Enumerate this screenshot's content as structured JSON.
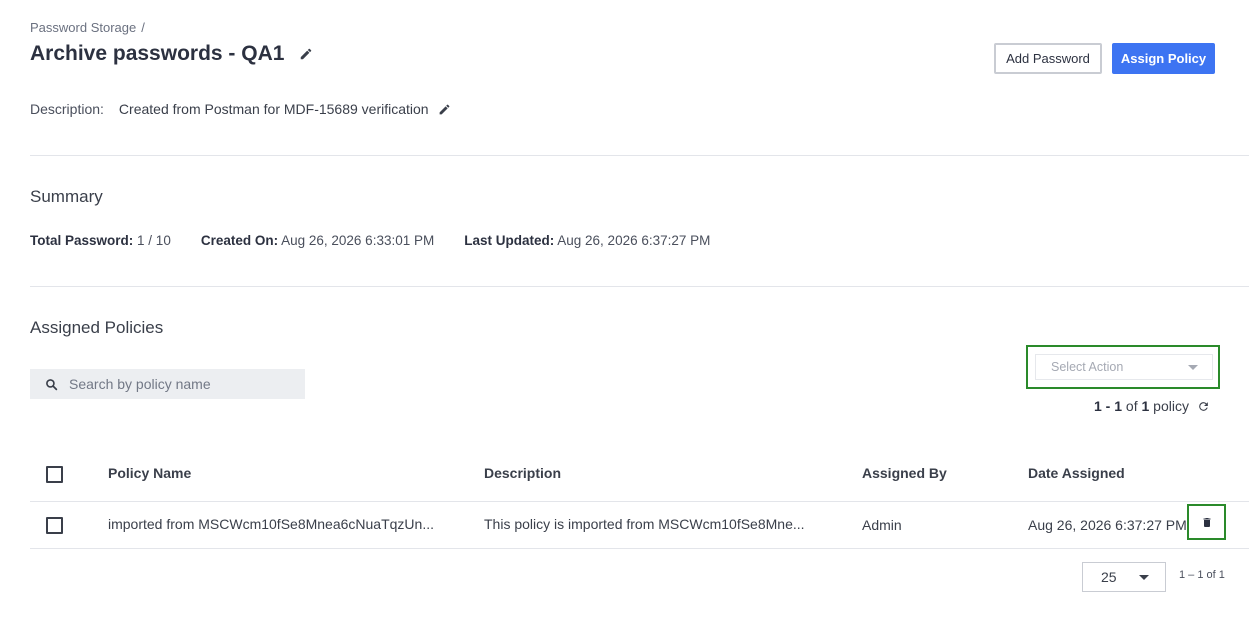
{
  "breadcrumb": {
    "root": "Password Storage",
    "separator": "/"
  },
  "header": {
    "title": "Archive passwords - QA1",
    "add_password_label": "Add Password",
    "assign_policy_label": "Assign Policy"
  },
  "description": {
    "label": "Description:",
    "value": "Created from Postman for MDF-15689 verification"
  },
  "summary": {
    "title": "Summary",
    "total_password_label": "Total Password:",
    "total_password_value": "1 / 10",
    "created_on_label": "Created On:",
    "created_on_value": "Aug 26, 2026 6:33:01 PM",
    "last_updated_label": "Last Updated:",
    "last_updated_value": "Aug 26, 2026 6:37:27 PM"
  },
  "assigned_policies": {
    "title": "Assigned Policies",
    "search_placeholder": "Search by policy name",
    "select_action_placeholder": "Select Action",
    "count": {
      "range": "1 - 1",
      "of": "of",
      "total": "1",
      "unit": "policy"
    },
    "columns": {
      "name": "Policy Name",
      "description": "Description",
      "assigned_by": "Assigned By",
      "date_assigned": "Date Assigned"
    },
    "rows": [
      {
        "name": "imported from MSCWcm10fSe8Mnea6cNuaTqzUn...",
        "description": "This policy is imported from MSCWcm10fSe8Mne...",
        "assigned_by": "Admin",
        "date_assigned": "Aug 26, 2026 6:37:27 PM"
      }
    ],
    "pagination": {
      "page_size": "25",
      "range_text": "1 – 1 of 1"
    }
  },
  "colors": {
    "primary": "#3d74f2",
    "highlight_border": "#2a8a2a"
  }
}
